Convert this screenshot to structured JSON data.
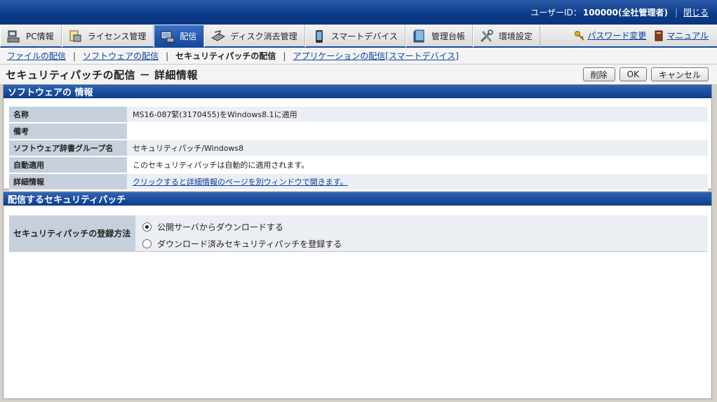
{
  "header": {
    "user_id_label": "ユーザーID：",
    "user_id_value": "100000(全社管理者)",
    "close_label": "閉じる"
  },
  "nav": {
    "tabs": [
      {
        "label": "PC情報",
        "icon": "pc-icon"
      },
      {
        "label": "ライセンス管理",
        "icon": "license-icon"
      },
      {
        "label": "配信",
        "icon": "delivery-icon",
        "active": true
      },
      {
        "label": "ディスク消去管理",
        "icon": "disk-erase-icon"
      },
      {
        "label": "スマートデバイス",
        "icon": "smart-device-icon"
      },
      {
        "label": "管理台帳",
        "icon": "ledger-icon"
      },
      {
        "label": "環境設定",
        "icon": "settings-tools-icon"
      }
    ],
    "password_change": "パスワード変更",
    "manual": "マニュアル"
  },
  "subnav": {
    "items": [
      {
        "label": "ファイルの配信",
        "link": true
      },
      {
        "label": "ソフトウェアの配信",
        "link": true
      },
      {
        "label": "セキュリティパッチの配信",
        "link": false
      },
      {
        "label": "アプリケーションの配信[スマートデバイス]",
        "link": true
      }
    ]
  },
  "page": {
    "title": "セキュリティパッチの配信 － 詳細情報",
    "delete_label": "削除",
    "ok_label": "OK",
    "cancel_label": "キャンセル"
  },
  "software_info": {
    "heading": "ソフトウェアの 情報",
    "rows": [
      {
        "label": "名称",
        "value": "MS16-087緊(3170455)をWindows8.1に適用"
      },
      {
        "label": "備考",
        "value": ""
      },
      {
        "label": "ソフトウェア辞書グループ名",
        "value": "セキュリティパッチ/Windows8"
      },
      {
        "label": "自動適用",
        "value": "このセキュリティパッチは自動的に適用されます。"
      },
      {
        "label": "詳細情報",
        "value": "クリックすると詳細情報のページを別ウィンドウで開きます。",
        "link": true
      }
    ]
  },
  "deliver": {
    "heading": "配信するセキュリティパッチ",
    "method_label": "セキュリティパッチの登録方法",
    "options": [
      {
        "label": "公開サーバからダウンロードする",
        "selected": true
      },
      {
        "label": "ダウンロード済みセキュリティパッチを登録する",
        "selected": false
      }
    ]
  }
}
